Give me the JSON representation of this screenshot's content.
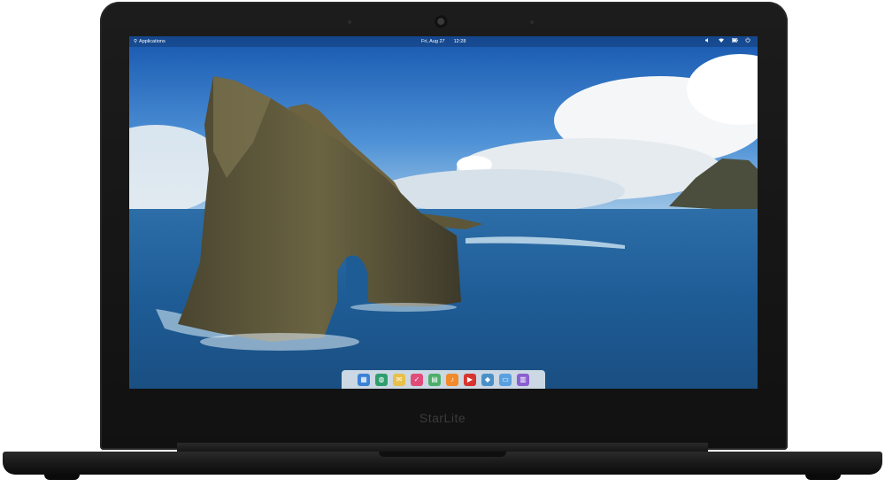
{
  "device": {
    "brand": "StarLite"
  },
  "top_panel": {
    "applications_label": "Applications",
    "date": "Fri, Aug 27",
    "time": "12:28",
    "indicators": [
      "volume-icon",
      "wifi-icon",
      "battery-icon",
      "power-icon"
    ]
  },
  "dock": {
    "apps": [
      {
        "name": "multitasking-view",
        "color": "#3b82d6",
        "glyph": "▦"
      },
      {
        "name": "web-browser",
        "color": "#2f9e6f",
        "glyph": "◍"
      },
      {
        "name": "mail",
        "color": "#e8c04a",
        "glyph": "✉"
      },
      {
        "name": "tasks",
        "color": "#e14b7a",
        "glyph": "✓"
      },
      {
        "name": "calendar",
        "color": "#4cae6a",
        "glyph": "▤"
      },
      {
        "name": "music",
        "color": "#f08a2b",
        "glyph": "♪"
      },
      {
        "name": "videos",
        "color": "#d8342f",
        "glyph": "▶"
      },
      {
        "name": "photos",
        "color": "#4a90c8",
        "glyph": "◆"
      },
      {
        "name": "files",
        "color": "#5aa0e0",
        "glyph": "▭"
      },
      {
        "name": "appcenter",
        "color": "#8a5fd0",
        "glyph": "▥"
      }
    ]
  },
  "colors": {
    "sky_top": "#1d5fb0",
    "sky_bottom": "#6aa6dd",
    "ocean": "#1d5f9c",
    "rock": "#5b5236"
  }
}
